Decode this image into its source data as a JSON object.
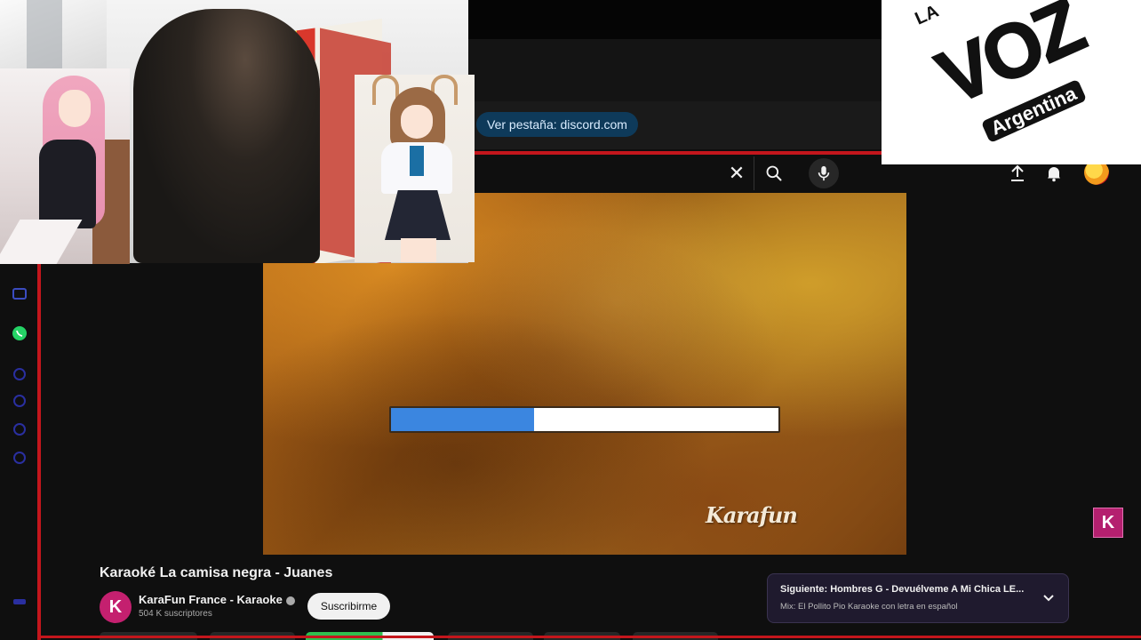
{
  "browser": {
    "discord_hint": "Ver pestaña: discord.com"
  },
  "header": {
    "clear_icon": "close-icon",
    "search_icon": "search-icon",
    "mic_icon": "mic-icon",
    "upload_icon": "upload-icon",
    "bell_icon": "bell-icon"
  },
  "player": {
    "watermark": "Karafun",
    "progress": 0.37,
    "progress_color": "#3b86e0",
    "corner_badge": "K"
  },
  "video": {
    "title": "Karaoké La camisa negra - Juanes",
    "channel_name": "KaraFun France - Karaoke",
    "channel_avatar": "K",
    "subscribers": "504 K suscriptores",
    "subscribe_label": "Suscribirme"
  },
  "up_next": {
    "title": "Siguiente: Hombres G - Devuélveme A Mi Chica LE...",
    "playlist": "Mix: El Pollito Pio Karaoke con letra en español"
  },
  "overlay": {
    "logo_la": "LA",
    "logo_main": "VOZ",
    "logo_sub": "Argentina"
  },
  "colors": {
    "accent_red": "#c4161c",
    "karafun_pink": "#b4206f",
    "background": "#0f0f0f"
  }
}
